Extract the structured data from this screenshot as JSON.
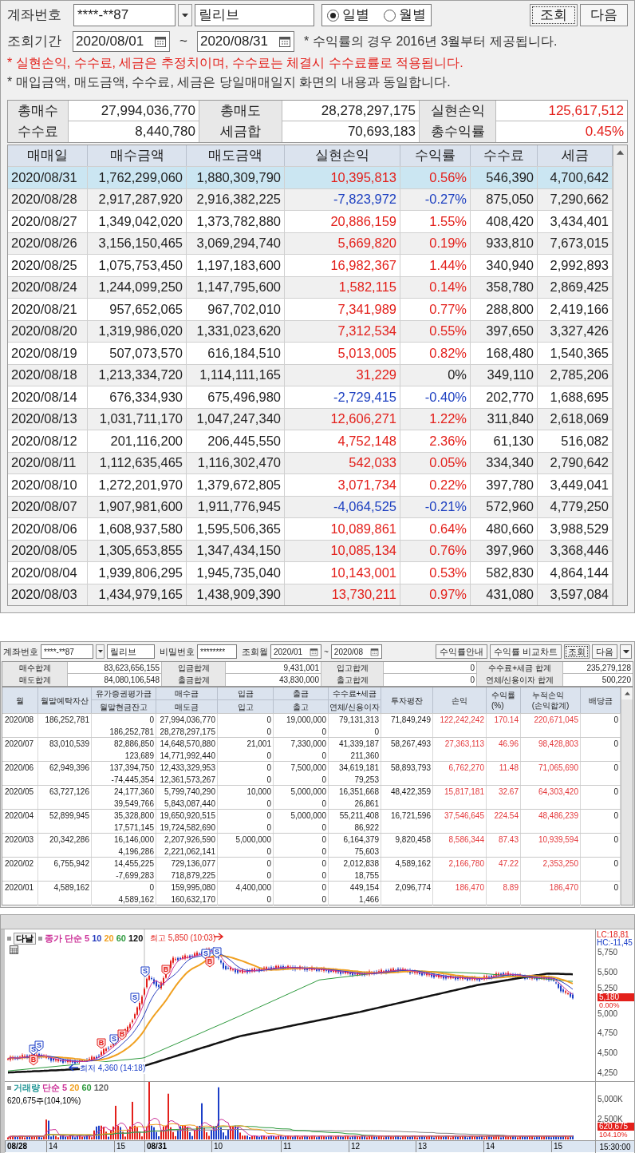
{
  "daily_panel": {
    "account_label": "계좌번호",
    "account_number": "****-**87",
    "account_name": "릴리브",
    "radios": [
      {
        "label": "일별",
        "selected": true
      },
      {
        "label": "월별",
        "selected": false
      }
    ],
    "buttons": [
      {
        "label": "조회",
        "focused": true
      },
      {
        "label": "다음",
        "focused": false
      }
    ],
    "period_label": "조회기간",
    "start_date": "2020/08/01",
    "tilde": "~",
    "end_date": "2020/08/31",
    "period_note": "* 수익률의 경우 2016년 3월부터 제공됩니다.",
    "notes": [
      {
        "text": "* 실현손익, 수수료, 세금은 추정치이며, 수수료는 체결시 수수료률로 적용됩니다.",
        "kind": "warning"
      },
      {
        "text": "* 매입금액, 매도금액, 수수료, 세금은 당일매매일지 화면의 내용과 동일합니다.",
        "kind": "info"
      }
    ],
    "summary": [
      [
        {
          "label": "총매수",
          "value": "27,994,036,770",
          "color": "#222222"
        },
        {
          "label": "총매도",
          "value": "28,278,297,175",
          "color": "#222222"
        },
        {
          "label": "실현손익",
          "value": "125,617,512",
          "color": "#e3201b"
        }
      ],
      [
        {
          "label": "수수료",
          "value": "8,440,780",
          "color": "#222222"
        },
        {
          "label": "세금합",
          "value": "70,693,183",
          "color": "#222222"
        },
        {
          "label": "총수익률",
          "value": "0.45%",
          "color": "#e3201b"
        }
      ]
    ],
    "columns": [
      "매매일",
      "매수금액",
      "매도금액",
      "실현손익",
      "수익률",
      "수수료",
      "세금"
    ],
    "rows": [
      {
        "date": "2020/08/31",
        "buy": "1,762,299,060",
        "sell": "1,880,309,790",
        "pnl": {
          "text": "10,395,813",
          "color": "#e3201b"
        },
        "rate": {
          "text": "0.56%",
          "color": "#e3201b"
        },
        "fee": "546,390",
        "tax": "4,700,642",
        "selected": true
      },
      {
        "date": "2020/08/28",
        "buy": "2,917,287,920",
        "sell": "2,916,382,225",
        "pnl": {
          "text": "-7,823,972",
          "color": "#1c3fc0"
        },
        "rate": {
          "text": "-0.27%",
          "color": "#1c3fc0"
        },
        "fee": "875,050",
        "tax": "7,290,662",
        "selected": false
      },
      {
        "date": "2020/08/27",
        "buy": "1,349,042,020",
        "sell": "1,373,782,880",
        "pnl": {
          "text": "20,886,159",
          "color": "#e3201b"
        },
        "rate": {
          "text": "1.55%",
          "color": "#e3201b"
        },
        "fee": "408,420",
        "tax": "3,434,401",
        "selected": false
      },
      {
        "date": "2020/08/26",
        "buy": "3,156,150,465",
        "sell": "3,069,294,740",
        "pnl": {
          "text": "5,669,820",
          "color": "#e3201b"
        },
        "rate": {
          "text": "0.19%",
          "color": "#e3201b"
        },
        "fee": "933,810",
        "tax": "7,673,015",
        "selected": false
      },
      {
        "date": "2020/08/25",
        "buy": "1,075,753,450",
        "sell": "1,197,183,600",
        "pnl": {
          "text": "16,982,367",
          "color": "#e3201b"
        },
        "rate": {
          "text": "1.44%",
          "color": "#e3201b"
        },
        "fee": "340,940",
        "tax": "2,992,893",
        "selected": false
      },
      {
        "date": "2020/08/24",
        "buy": "1,244,099,250",
        "sell": "1,147,795,600",
        "pnl": {
          "text": "1,582,115",
          "color": "#e3201b"
        },
        "rate": {
          "text": "0.14%",
          "color": "#e3201b"
        },
        "fee": "358,780",
        "tax": "2,869,425",
        "selected": false
      },
      {
        "date": "2020/08/21",
        "buy": "957,652,065",
        "sell": "967,702,010",
        "pnl": {
          "text": "7,341,989",
          "color": "#e3201b"
        },
        "rate": {
          "text": "0.77%",
          "color": "#e3201b"
        },
        "fee": "288,800",
        "tax": "2,419,166",
        "selected": false
      },
      {
        "date": "2020/08/20",
        "buy": "1,319,986,020",
        "sell": "1,331,023,620",
        "pnl": {
          "text": "7,312,534",
          "color": "#e3201b"
        },
        "rate": {
          "text": "0.55%",
          "color": "#e3201b"
        },
        "fee": "397,650",
        "tax": "3,327,426",
        "selected": false
      },
      {
        "date": "2020/08/19",
        "buy": "507,073,570",
        "sell": "616,184,510",
        "pnl": {
          "text": "5,013,005",
          "color": "#e3201b"
        },
        "rate": {
          "text": "0.82%",
          "color": "#e3201b"
        },
        "fee": "168,480",
        "tax": "1,540,365",
        "selected": false
      },
      {
        "date": "2020/08/18",
        "buy": "1,213,334,720",
        "sell": "1,114,111,165",
        "pnl": {
          "text": "31,229",
          "color": "#e3201b"
        },
        "rate": {
          "text": "0%",
          "color": "#222222"
        },
        "fee": "349,110",
        "tax": "2,785,206",
        "selected": false
      },
      {
        "date": "2020/08/14",
        "buy": "676,334,930",
        "sell": "675,496,980",
        "pnl": {
          "text": "-2,729,415",
          "color": "#1c3fc0"
        },
        "rate": {
          "text": "-0.40%",
          "color": "#1c3fc0"
        },
        "fee": "202,770",
        "tax": "1,688,695",
        "selected": false
      },
      {
        "date": "2020/08/13",
        "buy": "1,031,711,170",
        "sell": "1,047,247,340",
        "pnl": {
          "text": "12,606,271",
          "color": "#e3201b"
        },
        "rate": {
          "text": "1.22%",
          "color": "#e3201b"
        },
        "fee": "311,840",
        "tax": "2,618,069",
        "selected": false
      },
      {
        "date": "2020/08/12",
        "buy": "201,116,200",
        "sell": "206,445,550",
        "pnl": {
          "text": "4,752,148",
          "color": "#e3201b"
        },
        "rate": {
          "text": "2.36%",
          "color": "#e3201b"
        },
        "fee": "61,130",
        "tax": "516,082",
        "selected": false
      },
      {
        "date": "2020/08/11",
        "buy": "1,112,635,465",
        "sell": "1,116,302,470",
        "pnl": {
          "text": "542,033",
          "color": "#e3201b"
        },
        "rate": {
          "text": "0.05%",
          "color": "#e3201b"
        },
        "fee": "334,340",
        "tax": "2,790,642",
        "selected": false
      },
      {
        "date": "2020/08/10",
        "buy": "1,272,201,970",
        "sell": "1,379,672,805",
        "pnl": {
          "text": "3,071,734",
          "color": "#e3201b"
        },
        "rate": {
          "text": "0.22%",
          "color": "#e3201b"
        },
        "fee": "397,780",
        "tax": "3,449,041",
        "selected": false
      },
      {
        "date": "2020/08/07",
        "buy": "1,907,981,600",
        "sell": "1,911,776,945",
        "pnl": {
          "text": "-4,064,525",
          "color": "#1c3fc0"
        },
        "rate": {
          "text": "-0.21%",
          "color": "#1c3fc0"
        },
        "fee": "572,960",
        "tax": "4,779,250",
        "selected": false
      },
      {
        "date": "2020/08/06",
        "buy": "1,608,937,580",
        "sell": "1,595,506,365",
        "pnl": {
          "text": "10,089,861",
          "color": "#e3201b"
        },
        "rate": {
          "text": "0.64%",
          "color": "#e3201b"
        },
        "fee": "480,660",
        "tax": "3,988,529",
        "selected": false
      },
      {
        "date": "2020/08/05",
        "buy": "1,305,653,855",
        "sell": "1,347,434,150",
        "pnl": {
          "text": "10,085,134",
          "color": "#e3201b"
        },
        "rate": {
          "text": "0.76%",
          "color": "#e3201b"
        },
        "fee": "397,960",
        "tax": "3,368,446",
        "selected": false
      },
      {
        "date": "2020/08/04",
        "buy": "1,939,806,295",
        "sell": "1,945,735,040",
        "pnl": {
          "text": "10,143,001",
          "color": "#e3201b"
        },
        "rate": {
          "text": "0.53%",
          "color": "#e3201b"
        },
        "fee": "582,830",
        "tax": "4,864,144",
        "selected": false
      },
      {
        "date": "2020/08/03",
        "buy": "1,434,979,165",
        "sell": "1,438,909,390",
        "pnl": {
          "text": "13,730,211",
          "color": "#e3201b"
        },
        "rate": {
          "text": "0.97%",
          "color": "#e3201b"
        },
        "fee": "431,080",
        "tax": "3,597,084",
        "selected": false
      }
    ]
  },
  "monthly_panel": {
    "account_label": "계좌번호",
    "account_number": "****-**87",
    "account_name": "릴리브",
    "password_label": "비밀번호",
    "password": "********",
    "month_label": "조회월",
    "start_month": "2020/01",
    "tilde": "~",
    "end_month": "2020/08",
    "buttons": [
      {
        "label": "수익률안내",
        "focused": false
      },
      {
        "label": "수익률 비교차트",
        "focused": false
      },
      {
        "label": "조회",
        "focused": true
      },
      {
        "label": "다음",
        "focused": false
      }
    ],
    "summary": [
      [
        {
          "label": "매수합계",
          "value": "83,623,656,155"
        },
        {
          "label": "입금합계",
          "value": "9,431,001"
        },
        {
          "label": "입고합계",
          "value": "0"
        },
        {
          "label": "수수료+세금 합계",
          "value": "235,279,128"
        }
      ],
      [
        {
          "label": "매도합계",
          "value": "84,080,106,548"
        },
        {
          "label": "출금합계",
          "value": "43,830,000"
        },
        {
          "label": "출고합계",
          "value": "0"
        },
        {
          "label": "연체/신용이자 합계",
          "value": "500,220"
        }
      ]
    ],
    "columns": [
      {
        "label": "월",
        "kind": "single"
      },
      {
        "label": "월말예탁자산",
        "kind": "single"
      },
      {
        "label": "유가증권평가금",
        "sub": "월말현금잔고",
        "kind": "split"
      },
      {
        "label": "매수금",
        "sub": "매도금",
        "kind": "split"
      },
      {
        "label": "입금",
        "sub": "입고",
        "kind": "split"
      },
      {
        "label": "출금",
        "sub": "출고",
        "kind": "split"
      },
      {
        "label": "수수료+세금",
        "sub": "연체/신용이자",
        "kind": "split"
      },
      {
        "label": "투자평잔",
        "kind": "single"
      },
      {
        "label": "손익",
        "kind": "single"
      },
      {
        "label": "수익률",
        "sub": "(%)",
        "kind": "two_line"
      },
      {
        "label": "누적손익",
        "sub": "(손익합계)",
        "kind": "two_line"
      },
      {
        "label": "배당금",
        "kind": "single"
      }
    ],
    "rows": [
      {
        "month": "2020/08",
        "assets": "186,252,781",
        "securities": "0",
        "cash": "186,252,781",
        "buy": "27,994,036,770",
        "sell": "28,278,297,175",
        "deposit": "0",
        "stock_in": "0",
        "withdrawal": "19,000,000",
        "stock_out": "0",
        "fees_taxes": "79,131,313",
        "interest": "0",
        "avg_invest": "71,849,249",
        "pnl": "122,242,242",
        "rate": "170.14",
        "cumulative": "220,671,045",
        "dividend": "0"
      },
      {
        "month": "2020/07",
        "assets": "83,010,539",
        "securities": "82,886,850",
        "cash": "123,689",
        "buy": "14,648,570,880",
        "sell": "14,771,992,440",
        "deposit": "21,001",
        "stock_in": "0",
        "withdrawal": "7,330,000",
        "stock_out": "0",
        "fees_taxes": "41,339,187",
        "interest": "211,360",
        "avg_invest": "58,267,493",
        "pnl": "27,363,113",
        "rate": "46.96",
        "cumulative": "98,428,803",
        "dividend": "0"
      },
      {
        "month": "2020/06",
        "assets": "62,949,396",
        "securities": "137,394,750",
        "cash": "-74,445,354",
        "buy": "12,433,329,953",
        "sell": "12,361,573,267",
        "deposit": "0",
        "stock_in": "0",
        "withdrawal": "7,500,000",
        "stock_out": "0",
        "fees_taxes": "34,619,181",
        "interest": "79,253",
        "avg_invest": "58,893,793",
        "pnl": "6,762,270",
        "rate": "11.48",
        "cumulative": "71,065,690",
        "dividend": "0"
      },
      {
        "month": "2020/05",
        "assets": "63,727,126",
        "securities": "24,177,360",
        "cash": "39,549,766",
        "buy": "5,799,740,290",
        "sell": "5,843,087,440",
        "deposit": "10,000",
        "stock_in": "0",
        "withdrawal": "5,000,000",
        "stock_out": "0",
        "fees_taxes": "16,351,668",
        "interest": "26,861",
        "avg_invest": "48,422,359",
        "pnl": "15,817,181",
        "rate": "32.67",
        "cumulative": "64,303,420",
        "dividend": "0"
      },
      {
        "month": "2020/04",
        "assets": "52,899,945",
        "securities": "35,328,800",
        "cash": "17,571,145",
        "buy": "19,650,920,515",
        "sell": "19,724,582,690",
        "deposit": "0",
        "stock_in": "0",
        "withdrawal": "5,000,000",
        "stock_out": "0",
        "fees_taxes": "55,211,408",
        "interest": "86,922",
        "avg_invest": "16,721,596",
        "pnl": "37,546,645",
        "rate": "224.54",
        "cumulative": "48,486,239",
        "dividend": "0"
      },
      {
        "month": "2020/03",
        "assets": "20,342,286",
        "securities": "16,146,000",
        "cash": "4,196,286",
        "buy": "2,207,926,590",
        "sell": "2,221,062,141",
        "deposit": "5,000,000",
        "stock_in": "0",
        "withdrawal": "0",
        "stock_out": "0",
        "fees_taxes": "6,164,379",
        "interest": "75,603",
        "avg_invest": "9,820,458",
        "pnl": "8,586,344",
        "rate": "87.43",
        "cumulative": "10,939,594",
        "dividend": "0"
      },
      {
        "month": "2020/02",
        "assets": "6,755,942",
        "securities": "14,455,225",
        "cash": "-7,699,283",
        "buy": "729,136,077",
        "sell": "718,879,225",
        "deposit": "0",
        "stock_in": "0",
        "withdrawal": "0",
        "stock_out": "0",
        "fees_taxes": "2,012,838",
        "interest": "18,755",
        "avg_invest": "4,589,162",
        "pnl": "2,166,780",
        "rate": "47.22",
        "cumulative": "2,353,250",
        "dividend": "0"
      },
      {
        "month": "2020/01",
        "assets": "4,589,162",
        "securities": "0",
        "cash": "4,589,162",
        "buy": "159,995,080",
        "sell": "160,632,170",
        "deposit": "4,400,000",
        "stock_in": "0",
        "withdrawal": "0",
        "stock_out": "0",
        "fees_taxes": "449,154",
        "interest": "1,466",
        "avg_invest": "2,096,774",
        "pnl": "186,470",
        "rate": "8.89",
        "cumulative": "186,470",
        "dividend": "0"
      }
    ]
  },
  "chart_panel": {
    "symbol": "다날",
    "price_legend": [
      {
        "label": "종가 단순 5",
        "color": "#cc3399"
      },
      {
        "label": "10",
        "color": "#2a3fbf"
      },
      {
        "label": "20",
        "color": "#f0a020"
      },
      {
        "label": "60",
        "color": "#2e9a3e"
      },
      {
        "label": "120",
        "color": "#111111"
      }
    ],
    "high_label": "최고 5,850 (10:03)",
    "low_label": "최저 4,360 (14:18)",
    "trade_markers": [
      {
        "kind": "sell",
        "label": "S"
      },
      {
        "kind": "sell",
        "label": "S"
      },
      {
        "kind": "buy",
        "label": "B"
      },
      {
        "kind": "buy",
        "label": "B"
      },
      {
        "kind": "sell",
        "label": "S"
      },
      {
        "kind": "buy",
        "label": "B"
      },
      {
        "kind": "sell",
        "label": "S"
      },
      {
        "kind": "sell",
        "label": "S"
      },
      {
        "kind": "buy",
        "label": "B"
      },
      {
        "kind": "sell",
        "label": "S"
      },
      {
        "kind": "buy",
        "label": "B"
      },
      {
        "kind": "sell",
        "label": "S"
      }
    ],
    "lc": "LC:18,81",
    "hc": "HC:-11,45",
    "price_ticks": [
      "5,750",
      "5,500",
      "5,250",
      "5,000",
      "4,750",
      "4,500",
      "4,250"
    ],
    "price_tag": "5,180",
    "change_tag": "0.00%",
    "volume_legend": [
      {
        "label": "거래량",
        "color": "#2a9a9a"
      },
      {
        "label": "단순 5",
        "color": "#cc3399"
      },
      {
        "label": "20",
        "color": "#f0a020"
      },
      {
        "label": "60",
        "color": "#2e9a3e"
      },
      {
        "label": "120",
        "color": "#666666"
      }
    ],
    "volume_readout": "620,675주(104,10%)",
    "volume_ticks": [
      "5,000K",
      "2,500K"
    ],
    "volume_tag": "620,675",
    "volume_ratio_tag": "104.10%",
    "x_labels": [
      {
        "label": "08/28",
        "kind": "date"
      },
      {
        "label": "14",
        "kind": "hour"
      },
      {
        "label": "15",
        "kind": "hour"
      },
      {
        "label": "08/31",
        "kind": "date"
      },
      {
        "label": "10",
        "kind": "hour"
      },
      {
        "label": "11",
        "kind": "hour"
      },
      {
        "label": "12",
        "kind": "hour"
      },
      {
        "label": "13",
        "kind": "hour"
      },
      {
        "label": "14",
        "kind": "hour"
      },
      {
        "label": "15",
        "kind": "hour"
      }
    ],
    "time": "15:30:00"
  }
}
